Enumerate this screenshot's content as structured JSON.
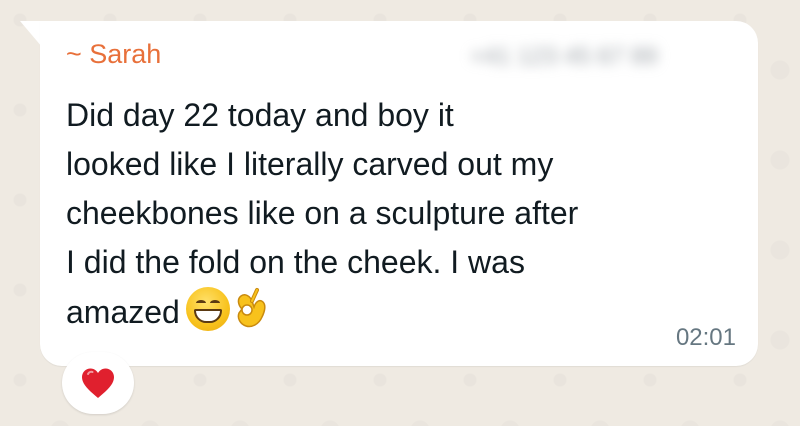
{
  "message": {
    "sender_name": "~ Sarah",
    "sender_phone": "+41 123 45 67 89",
    "text_lines": [
      "Did day 22 today and boy it",
      "looked like I literally carved out my",
      "cheekbones like on a sculpture after",
      "I did the fold on the cheek. I was",
      "amazed"
    ],
    "emojis": [
      "grinning-face",
      "ok-hand"
    ],
    "time": "02:01",
    "reaction": "red-heart"
  },
  "colors": {
    "background": "#efeae2",
    "bubble": "#ffffff",
    "sender_name": "#e8703a",
    "text": "#111b21",
    "time": "#667781",
    "heart": "#e0202e"
  }
}
